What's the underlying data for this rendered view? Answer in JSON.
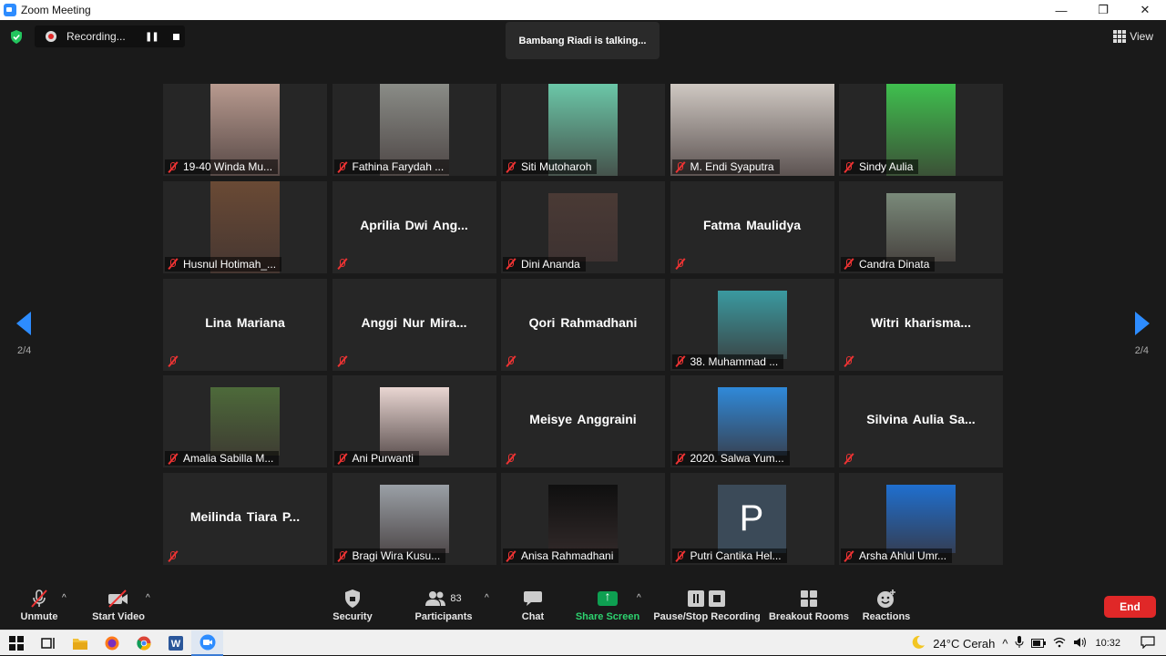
{
  "window": {
    "title": "Zoom Meeting",
    "buttons": [
      "—",
      "❐",
      "✕"
    ]
  },
  "recording": {
    "label": "Recording..."
  },
  "talking": "Bambang Riadi is talking...",
  "view_label": "View",
  "page_indicator": "2/4",
  "tiles": [
    {
      "name": "19-40 Winda Mu...",
      "mode": "video",
      "color": "#b89a8f"
    },
    {
      "name": "Fathina Farydah ...",
      "mode": "video",
      "color": "#8a8c87"
    },
    {
      "name": "Siti Mutoharoh",
      "mode": "video",
      "color": "#6bc7a8"
    },
    {
      "name": "M. Endi Syaputra",
      "mode": "video-wide",
      "color": "#cfc8c2"
    },
    {
      "name": "Sindy Aulia",
      "mode": "video",
      "color": "#3fbf4e"
    },
    {
      "name": "Husnul Hotimah_...",
      "mode": "video",
      "color": "#6a4a35"
    },
    {
      "name": "Aprilia Dwi Ang...",
      "mode": "name"
    },
    {
      "name": "Dini Ananda",
      "mode": "video",
      "color": "#4a3a35"
    },
    {
      "name": "Fatma Maulidya",
      "mode": "name"
    },
    {
      "name": "Candra Dinata",
      "mode": "video",
      "color": "#7a8a7a"
    },
    {
      "name": "Lina Mariana",
      "mode": "name"
    },
    {
      "name": "Anggi Nur Mira...",
      "mode": "name"
    },
    {
      "name": "Qori Rahmadhani",
      "mode": "name"
    },
    {
      "name": "38. Muhammad ...",
      "mode": "video",
      "color": "#3a9aa0"
    },
    {
      "name": "Witri kharisma...",
      "mode": "name"
    },
    {
      "name": "Amalia Sabilla M...",
      "mode": "video",
      "color": "#4d6a3a"
    },
    {
      "name": "Ani Purwanti",
      "mode": "video",
      "color": "#e9d6d2"
    },
    {
      "name": "Meisye Anggraini",
      "mode": "name"
    },
    {
      "name": "2020. Salwa Yum...",
      "mode": "video",
      "color": "#2f89d9"
    },
    {
      "name": "Silvina Aulia Sa...",
      "mode": "name"
    },
    {
      "name": "Meilinda Tiara P...",
      "mode": "name"
    },
    {
      "name": "Bragi Wira Kusu...",
      "mode": "video",
      "color": "#9aa0a6"
    },
    {
      "name": "Anisa Rahmadhani",
      "mode": "video",
      "color": "#0f0f0f"
    },
    {
      "name": "Putri Cantika Hel...",
      "mode": "avatar",
      "letter": "P"
    },
    {
      "name": "Arsha Ahlul Umr...",
      "mode": "video",
      "color": "#1f6fcf"
    }
  ],
  "toolbar": {
    "unmute": "Unmute",
    "start_video": "Start Video",
    "security": "Security",
    "participants": "Participants",
    "participants_count": "83",
    "chat": "Chat",
    "share_screen": "Share Screen",
    "pause_stop_recording": "Pause/Stop Recording",
    "breakout_rooms": "Breakout Rooms",
    "reactions": "Reactions",
    "end": "End"
  },
  "taskbar": {
    "weather": "24°C  Cerah",
    "time": "10:32"
  }
}
